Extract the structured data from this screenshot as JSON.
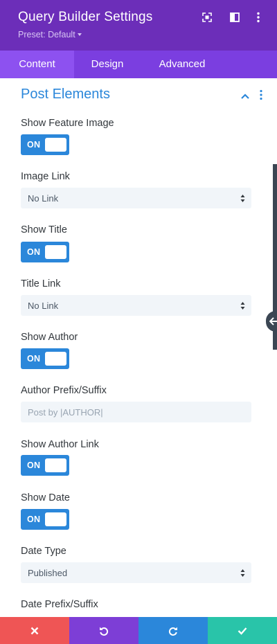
{
  "header": {
    "title": "Query Builder Settings",
    "preset": "Preset: Default",
    "icons": [
      "expand-icon",
      "split-view-icon",
      "more-vertical-icon"
    ],
    "colors": {
      "header_bg": "#6c2eb9",
      "tabs_bg": "#7b3ee0",
      "active_tab_bg": "#8d51f0"
    }
  },
  "tabs": [
    {
      "label": "Content",
      "active": true
    },
    {
      "label": "Design",
      "active": false
    },
    {
      "label": "Advanced",
      "active": false
    }
  ],
  "section": {
    "title": "Post Elements",
    "accent": "#2b87da"
  },
  "fields": {
    "show_feature_image": {
      "label": "Show Feature Image",
      "state": "ON"
    },
    "image_link": {
      "label": "Image Link",
      "value": "No Link"
    },
    "show_title": {
      "label": "Show Title",
      "state": "ON"
    },
    "title_link": {
      "label": "Title Link",
      "value": "No Link"
    },
    "show_author": {
      "label": "Show Author",
      "state": "ON"
    },
    "author_prefix": {
      "label": "Author Prefix/Suffix",
      "placeholder": "Post by |AUTHOR|"
    },
    "show_author_link": {
      "label": "Show Author Link",
      "state": "ON"
    },
    "show_date": {
      "label": "Show Date",
      "state": "ON"
    },
    "date_type": {
      "label": "Date Type",
      "value": "Published"
    },
    "date_prefix": {
      "label": "Date Prefix/Suffix"
    }
  },
  "footer": {
    "buttons": [
      "close-icon",
      "undo-icon",
      "redo-icon",
      "check-icon"
    ],
    "colors": {
      "cancel": "#ef5555",
      "undo": "#7d3ed6",
      "redo": "#2b87da",
      "save": "#29c4a9"
    }
  }
}
